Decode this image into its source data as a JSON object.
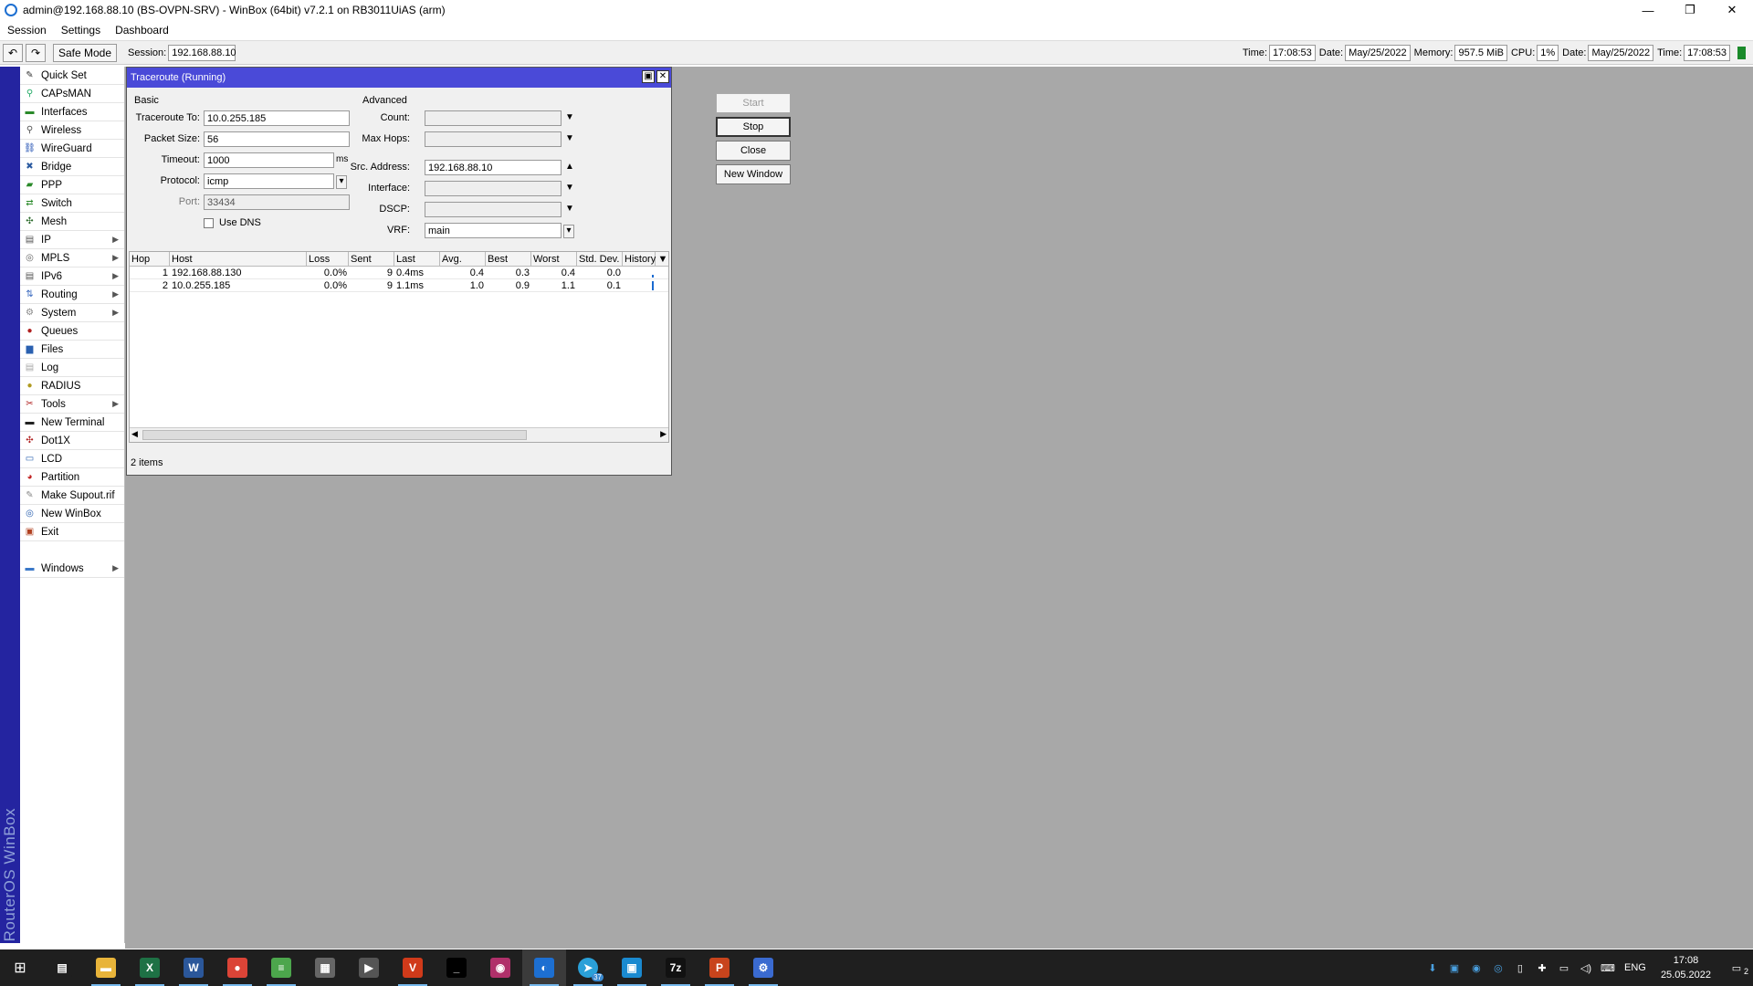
{
  "window": {
    "title": "admin@192.168.88.10 (BS-OVPN-SRV) - WinBox (64bit) v7.2.1 on RB3011UiAS (arm)"
  },
  "menu": [
    "Session",
    "Settings",
    "Dashboard"
  ],
  "toolbar": {
    "safe_mode": "Safe Mode",
    "session_label": "Session:",
    "session_value": "192.168.88.10",
    "status": {
      "time_label": "Time:",
      "time": "17:08:53",
      "date_label": "Date:",
      "date": "May/25/2022",
      "memory_label": "Memory:",
      "memory": "957.5 MiB",
      "cpu_label": "CPU:",
      "cpu": "1%",
      "date2_label": "Date:",
      "date2": "May/25/2022",
      "time2_label": "Time:",
      "time2": "17:08:53"
    }
  },
  "brand": "RouterOS WinBox",
  "sidebar": [
    {
      "label": "Quick Set",
      "icon": "quickset-icon",
      "sub": false
    },
    {
      "label": "CAPsMAN",
      "icon": "capsman-icon",
      "sub": false
    },
    {
      "label": "Interfaces",
      "icon": "interfaces-icon",
      "sub": false
    },
    {
      "label": "Wireless",
      "icon": "wireless-icon",
      "sub": false
    },
    {
      "label": "WireGuard",
      "icon": "wireguard-icon",
      "sub": false
    },
    {
      "label": "Bridge",
      "icon": "bridge-icon",
      "sub": false
    },
    {
      "label": "PPP",
      "icon": "ppp-icon",
      "sub": false
    },
    {
      "label": "Switch",
      "icon": "switch-icon",
      "sub": false
    },
    {
      "label": "Mesh",
      "icon": "mesh-icon",
      "sub": false
    },
    {
      "label": "IP",
      "icon": "ip-icon",
      "sub": true
    },
    {
      "label": "MPLS",
      "icon": "mpls-icon",
      "sub": true
    },
    {
      "label": "IPv6",
      "icon": "ipv6-icon",
      "sub": true
    },
    {
      "label": "Routing",
      "icon": "routing-icon",
      "sub": true
    },
    {
      "label": "System",
      "icon": "system-icon",
      "sub": true
    },
    {
      "label": "Queues",
      "icon": "queues-icon",
      "sub": false
    },
    {
      "label": "Files",
      "icon": "files-icon",
      "sub": false
    },
    {
      "label": "Log",
      "icon": "log-icon",
      "sub": false
    },
    {
      "label": "RADIUS",
      "icon": "radius-icon",
      "sub": false
    },
    {
      "label": "Tools",
      "icon": "tools-icon",
      "sub": true
    },
    {
      "label": "New Terminal",
      "icon": "terminal-icon",
      "sub": false
    },
    {
      "label": "Dot1X",
      "icon": "dot1x-icon",
      "sub": false
    },
    {
      "label": "LCD",
      "icon": "lcd-icon",
      "sub": false
    },
    {
      "label": "Partition",
      "icon": "partition-icon",
      "sub": false
    },
    {
      "label": "Make Supout.rif",
      "icon": "supout-icon",
      "sub": false
    },
    {
      "label": "New WinBox",
      "icon": "winbox-icon",
      "sub": false
    },
    {
      "label": "Exit",
      "icon": "exit-icon",
      "sub": false
    }
  ],
  "sidebar_windows": {
    "label": "Windows",
    "icon": "windows-list-icon"
  },
  "traceroute": {
    "title": "Traceroute (Running)",
    "basic_label": "Basic",
    "advanced_label": "Advanced",
    "fields": {
      "traceroute_to": {
        "label": "Traceroute To:",
        "value": "10.0.255.185"
      },
      "packet_size": {
        "label": "Packet Size:",
        "value": "56"
      },
      "timeout": {
        "label": "Timeout:",
        "value": "1000",
        "unit": "ms"
      },
      "protocol": {
        "label": "Protocol:",
        "value": "icmp"
      },
      "port": {
        "label": "Port:",
        "value": "33434"
      },
      "use_dns": {
        "label": "Use DNS",
        "checked": false
      },
      "count": {
        "label": "Count:",
        "value": ""
      },
      "max_hops": {
        "label": "Max Hops:",
        "value": ""
      },
      "src_address": {
        "label": "Src. Address:",
        "value": "192.168.88.10"
      },
      "interface": {
        "label": "Interface:",
        "value": ""
      },
      "dscp": {
        "label": "DSCP:",
        "value": ""
      },
      "vrf": {
        "label": "VRF:",
        "value": "main"
      }
    },
    "buttons": {
      "start": "Start",
      "stop": "Stop",
      "close": "Close",
      "new_window": "New Window"
    },
    "columns": [
      "Hop",
      "Host",
      "Loss",
      "Sent",
      "Last",
      "Avg.",
      "Best",
      "Worst",
      "Std. Dev.",
      "History"
    ],
    "rows": [
      {
        "hop": "1",
        "host": "192.168.88.130",
        "loss": "0.0%",
        "sent": "9",
        "last": "0.4ms",
        "avg": "0.4",
        "best": "0.3",
        "worst": "0.4",
        "stddev": "0.0"
      },
      {
        "hop": "2",
        "host": "10.0.255.185",
        "loss": "0.0%",
        "sent": "9",
        "last": "1.1ms",
        "avg": "1.0",
        "best": "0.9",
        "worst": "1.1",
        "stddev": "0.1"
      }
    ],
    "status": "2 items"
  },
  "taskbar": {
    "apps": [
      {
        "name": "task-view-icon",
        "glyph": "▤",
        "color": "#1f1f1f",
        "running": false
      },
      {
        "name": "file-explorer-icon",
        "glyph": "▬",
        "color": "#e8b43a",
        "running": true
      },
      {
        "name": "excel-icon",
        "glyph": "X",
        "color": "#1e7145",
        "running": true
      },
      {
        "name": "word-icon",
        "glyph": "W",
        "color": "#2b579a",
        "running": true
      },
      {
        "name": "chrome-icon",
        "glyph": "●",
        "color": "#db4437",
        "running": true
      },
      {
        "name": "notepad-icon",
        "glyph": "≡",
        "color": "#4ca64c",
        "running": true
      },
      {
        "name": "calculator-icon",
        "glyph": "▦",
        "color": "#666666",
        "running": false
      },
      {
        "name": "media-icon",
        "glyph": "▶",
        "color": "#555555",
        "running": false
      },
      {
        "name": "vlc-icon",
        "glyph": "V",
        "color": "#d03a1a",
        "running": true
      },
      {
        "name": "terminal-icon",
        "glyph": "_",
        "color": "#000000",
        "running": false
      },
      {
        "name": "network-icon",
        "glyph": "◉",
        "color": "#b0306a",
        "running": false
      },
      {
        "name": "winbox-app-icon",
        "glyph": "◐",
        "color": "#1d6fd1",
        "running": true
      },
      {
        "name": "telegram-icon",
        "glyph": "➤",
        "color": "#2aa0d8",
        "running": true
      },
      {
        "name": "remote-icon",
        "glyph": "▣",
        "color": "#1a8ad0",
        "running": true
      },
      {
        "name": "7zip-icon",
        "glyph": "7z",
        "color": "#111111",
        "running": true
      },
      {
        "name": "powerpoint-icon",
        "glyph": "P",
        "color": "#c8441c",
        "running": true
      },
      {
        "name": "network-mgr-icon",
        "glyph": "⚙",
        "color": "#3a6ad0",
        "running": true
      }
    ],
    "telegram_badge": "37",
    "tray": {
      "lang": "ENG",
      "time": "17:08",
      "date": "25.05.2022",
      "notifications": "2"
    }
  }
}
